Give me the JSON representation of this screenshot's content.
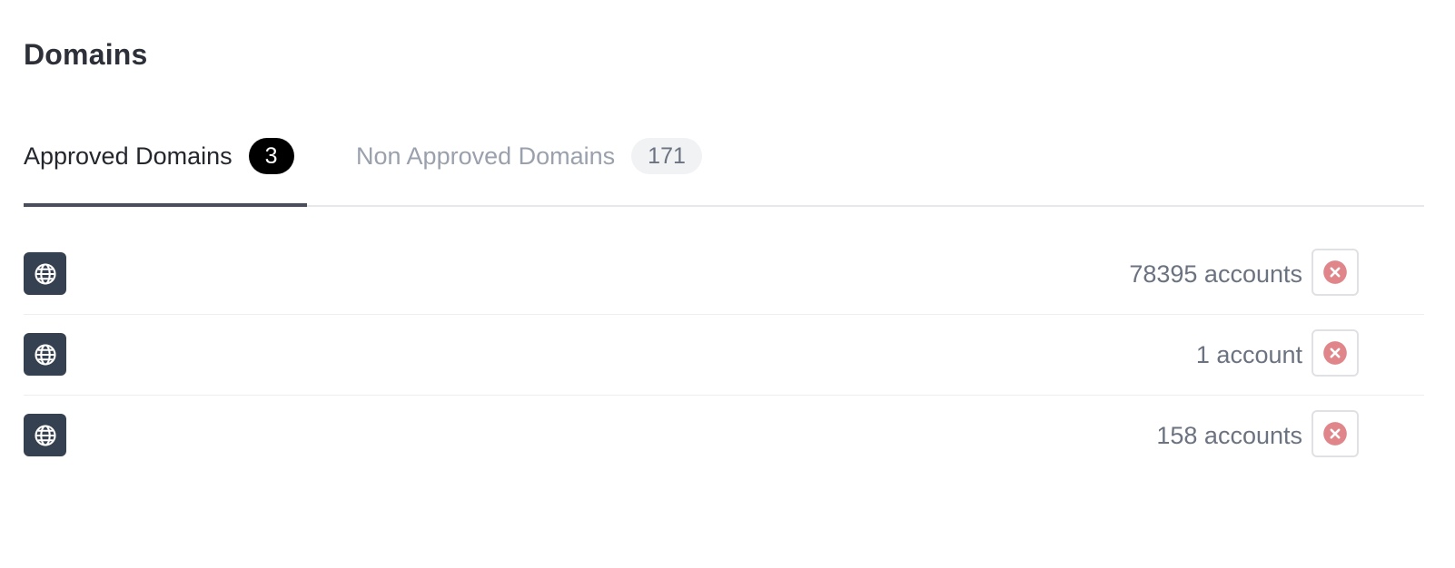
{
  "page": {
    "title": "Domains"
  },
  "tabs": [
    {
      "label": "Approved Domains",
      "count": "3",
      "active": true
    },
    {
      "label": "Non Approved Domains",
      "count": "171",
      "active": false
    }
  ],
  "domains": [
    {
      "icon": "globe-icon",
      "accounts": "78395 accounts",
      "action_icon": "remove-circle-icon"
    },
    {
      "icon": "globe-icon",
      "accounts": "1 account",
      "action_icon": "remove-circle-icon"
    },
    {
      "icon": "globe-icon",
      "accounts": "158 accounts",
      "action_icon": "remove-circle-icon"
    }
  ],
  "colors": {
    "icon_tile": "#354150",
    "active_badge": "#000000",
    "inactive_badge": "#f1f2f4",
    "active_tab_underline": "#4a4d5a",
    "remove_icon": "#e0868a"
  }
}
